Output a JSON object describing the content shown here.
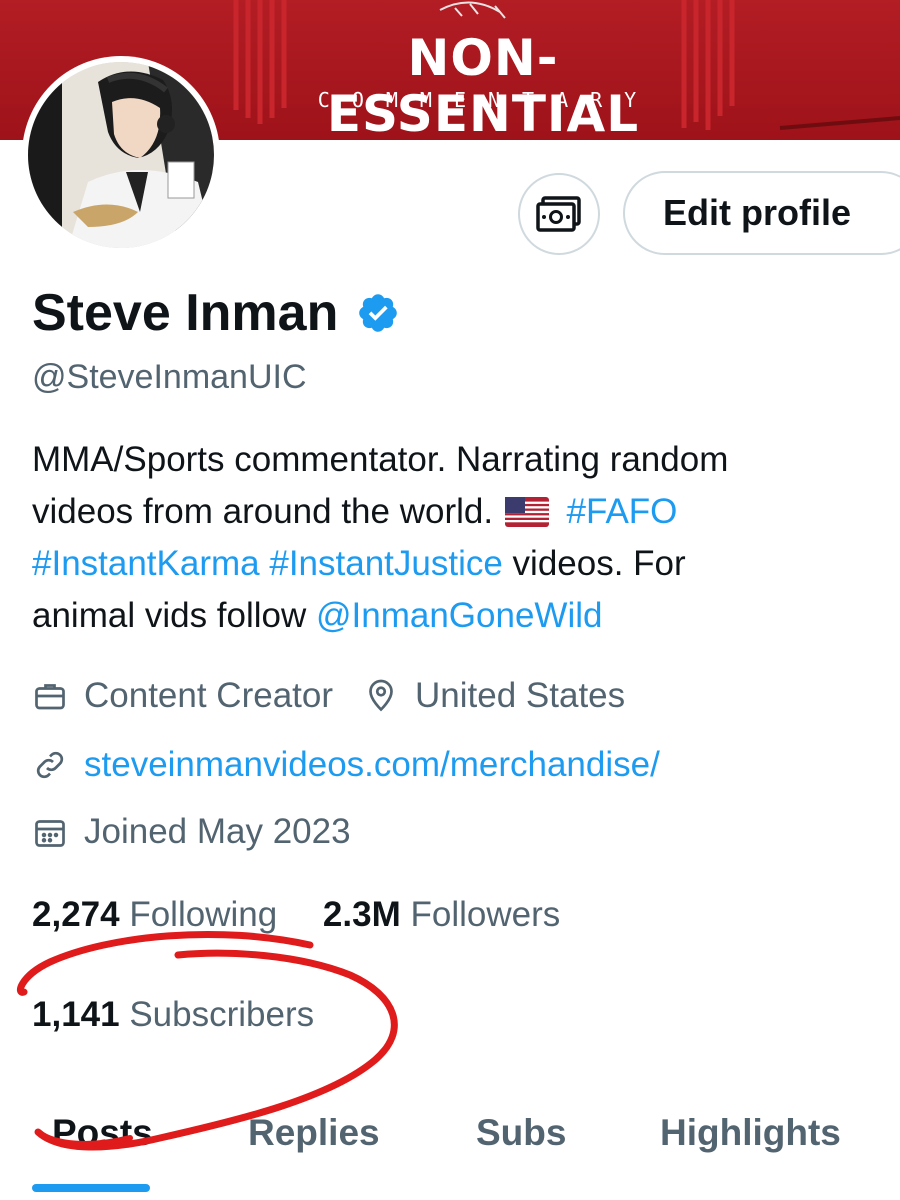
{
  "banner": {
    "title": "NON-ESSENTIAL",
    "subtitle": "COMMENTARY",
    "color": "#a8161d"
  },
  "profile": {
    "name": "Steve Inman",
    "handle": "@SteveInmanUIC",
    "verified_icon": "verified-badge-icon",
    "verified_color": "#1d9bf0"
  },
  "actions": {
    "tip_icon": "money-icon",
    "edit_label": "Edit profile"
  },
  "bio": {
    "line1": "MMA/Sports commentator.  Narrating random",
    "line2_text": "videos from around the world.",
    "flag": "us-flag-emoji",
    "hashtag_fafo": "#FAFO",
    "hashtag_karma": "#InstantKarma",
    "hashtag_justice": "#InstantJustice",
    "line3_tail": " videos. For",
    "line4_text": "animal vids follow ",
    "mention": "@InmanGoneWild",
    "link_color": "#1d9bf0"
  },
  "meta": {
    "category": "Content Creator",
    "category_icon": "briefcase-icon",
    "location": "United States",
    "location_icon": "location-pin-icon",
    "website": "steveinmanvideos.com/merchandise/",
    "website_icon": "link-icon",
    "joined": "Joined May 2023",
    "joined_icon": "calendar-icon"
  },
  "stats": {
    "following_count": "2,274",
    "following_label": "Following",
    "followers_count": "2.3M",
    "followers_label": "Followers",
    "subscribers_count": "1,141",
    "subscribers_label": "Subscribers"
  },
  "tabs": [
    {
      "label": "Posts",
      "active": true
    },
    {
      "label": "Replies",
      "active": false
    },
    {
      "label": "Subs",
      "active": false
    },
    {
      "label": "Highlights",
      "active": false
    }
  ],
  "annotation": {
    "type": "red-hand-drawn-circle",
    "color": "#e01b1b"
  }
}
